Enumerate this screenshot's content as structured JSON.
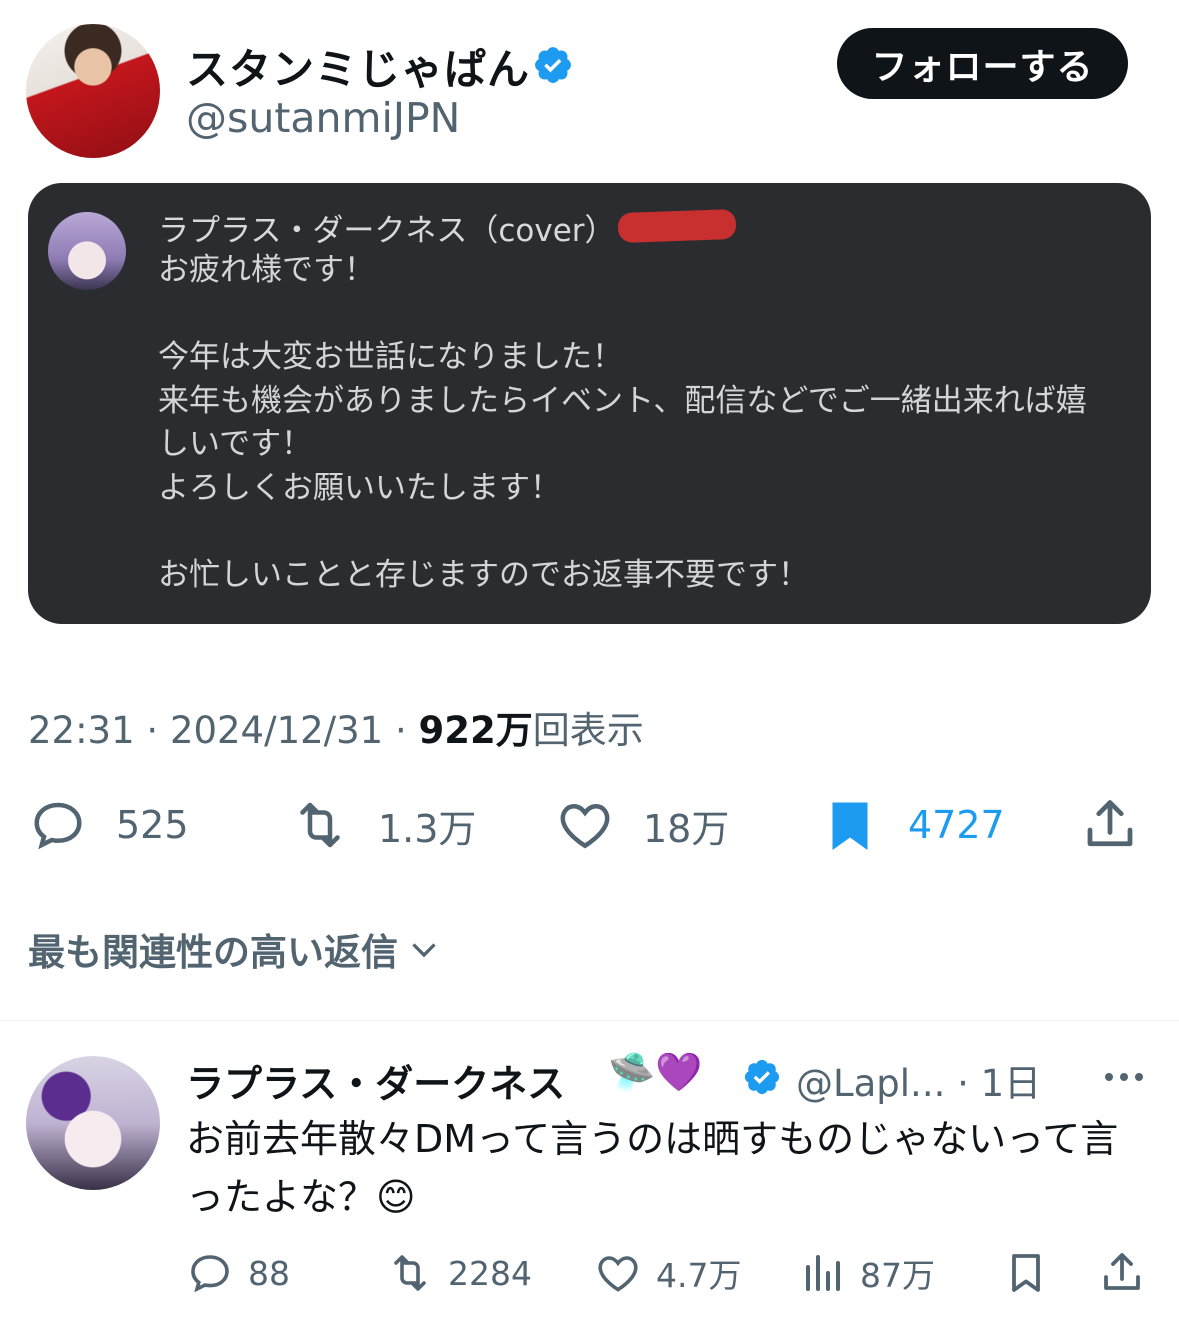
{
  "tweet": {
    "display_name": "スタンミじゃぱん",
    "handle": "@sutanmiJPN",
    "follow_label": "フォローする",
    "time": "22:31",
    "date": "2024/12/31",
    "views_count": "922万",
    "views_label": "回表示",
    "replies": "525",
    "retweets": "1.3万",
    "likes": "18万",
    "bookmarks": "4727",
    "bookmark_color": "#1d9bf0"
  },
  "card": {
    "name": "ラプラス・ダークネス（cover）",
    "lines": [
      "お疲れ様です！",
      "",
      "今年は大変お世話になりました！",
      "来年も機会がありましたらイベント、配信などでご一緒出来れば嬉",
      "しいです！",
      "よろしくお願いいたします！",
      "",
      "お忙しいことと存じますのでお返事不要です！"
    ]
  },
  "sort_label": "最も関連性の高い返信",
  "reply": {
    "name": "ラプラス・ダークネス",
    "emoji": "🛸💜",
    "handle": "@Lapl...",
    "age": "· 1日",
    "text": "お前去年散々DMって言うのは晒すものじゃないって言ったよな？😊",
    "replies": "88",
    "retweets": "2284",
    "likes": "4.7万",
    "views": "87万"
  },
  "icons": [
    "verified-badge-icon",
    "reply-icon",
    "retweet-icon",
    "like-icon",
    "bookmark-icon",
    "share-icon",
    "chevron-down-icon",
    "more-icon",
    "views-icon"
  ],
  "colors": {
    "text": "#0f1419",
    "secondary": "#536471",
    "accent": "#1d9bf0",
    "card_bg": "#2b2c30"
  }
}
